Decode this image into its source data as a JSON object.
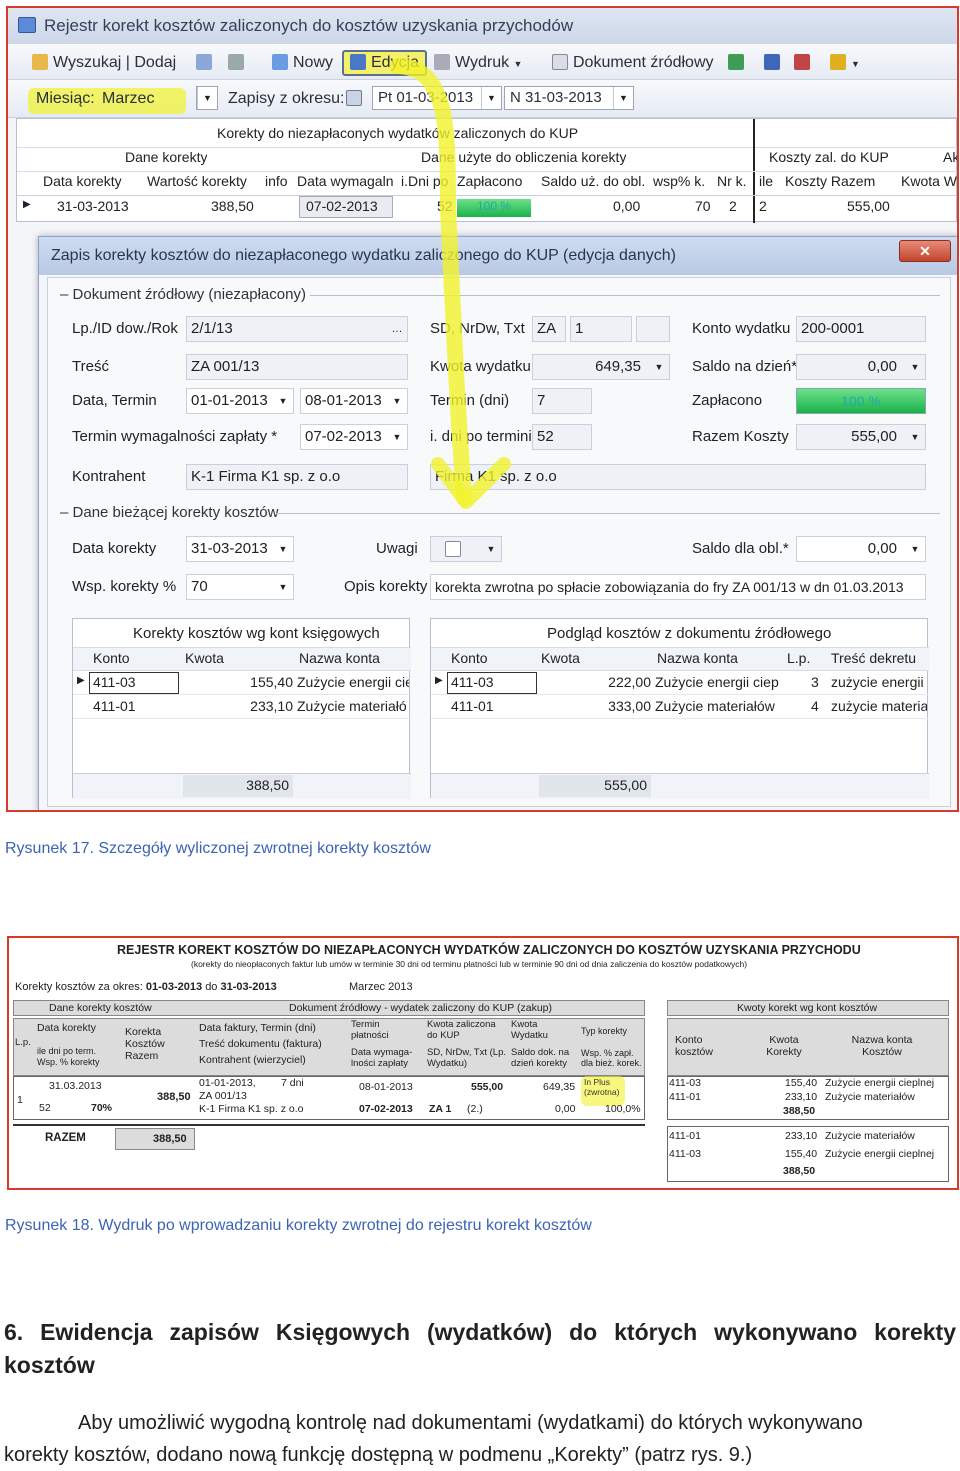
{
  "window": {
    "title": "Rejestr korekt kosztów zaliczonych do kosztów uzyskania przychodów"
  },
  "toolbar": {
    "search_add": "Wyszukaj | Dodaj",
    "new": "Nowy",
    "edit": "Edycja",
    "print": "Wydruk",
    "source_doc": "Dokument źródłowy"
  },
  "filter": {
    "month_label": "Miesiąc:",
    "month_value": "Marzec",
    "range_label": "Zapisy z okresu:",
    "from": "Pt 01-03-2013",
    "to": "N 31-03-2013"
  },
  "main_grid": {
    "band1": "Korekty do niezapłaconych wydatków zaliczonych do KUP",
    "band2a": "Dane korekty",
    "band2b": "Dane użyte do obliczenia korekty",
    "band2c": "Koszty zal. do KUP",
    "band2d": "Akt",
    "headers": [
      "Data korekty",
      "Wartość korekty",
      "info",
      "Data wymagaln",
      "i.Dni po",
      "Zapłacono",
      "Saldo uż. do obl.",
      "wsp% k.",
      "Nr k.",
      "ile",
      "Koszty Razem",
      "Kwota Wy"
    ],
    "row": {
      "date": "31-03-2013",
      "value": "388,50",
      "due": "07-02-2013",
      "days": "52",
      "paid": "100 %",
      "saldo": "0,00",
      "wsp": "70",
      "nr": "2",
      "ile": "2",
      "total": "555,00"
    }
  },
  "dialog": {
    "title": "Zapis korekty kosztów do niezapłaconego wydatku zaliczonego do KUP  (edycja danych)",
    "close": "✕",
    "section1": "Dokument źródłowy  (niezapłacony)",
    "lp_label": "Lp./ID dow./Rok",
    "lp_value": "2/1/13",
    "sd_label": "SD, NrDw, Txt",
    "sd_value": "ZA",
    "nr_value": "1",
    "konto_label": "Konto wydatku",
    "konto_value": "200-0001",
    "tresc_label": "Treść",
    "tresc_value": "ZA 001/13",
    "kwota_label": "Kwota wydatku",
    "kwota_value": "649,35",
    "saldo_dzien_label": "Saldo na dzień*",
    "saldo_dzien_value": "0,00",
    "data_label": "Data, Termin",
    "data_value": "01-01-2013",
    "termin_value": "08-01-2013",
    "termin_dni_label": "Termin (dni)",
    "termin_dni_value": "7",
    "zaplacono_label": "Zapłacono",
    "zaplacono_value": "100 %",
    "wymag_label": "Termin wymagalności zapłaty *",
    "wymag_value": "07-02-2013",
    "dni_po_label": "i. dni po terminie",
    "dni_po_value": "52",
    "razem_label": "Razem Koszty",
    "razem_value": "555,00",
    "kontrahent_label": "Kontrahent",
    "kontrahent_value": "K-1   Firma K1 sp. z o.o",
    "kontrahent_value2": "Firma K1 sp. z o.o",
    "section2": "Dane bieżącej korekty kosztów",
    "data_korekty_label": "Data korekty",
    "data_korekty_value": "31-03-2013",
    "uwagi_label": "Uwagi",
    "saldo_obl_label": "Saldo dla obl.*",
    "saldo_obl_value": "0,00",
    "wsp_label": "Wsp. korekty %",
    "wsp_value": "70",
    "opis_label": "Opis korekty",
    "opis_value": "korekta zwrotna po spłacie zobowiązania do fry ZA 001/13 w dn 01.03.2013",
    "left_grid": {
      "title": "Korekty kosztów wg kont księgowych",
      "headers": [
        "Konto",
        "Kwota",
        "Nazwa konta"
      ],
      "rows": [
        [
          "411-03",
          "155,40",
          "Zużycie energii cie"
        ],
        [
          "411-01",
          "233,10",
          "Zużycie materiałó"
        ]
      ],
      "total": "388,50"
    },
    "right_grid": {
      "title": "Podgląd kosztów z dokumentu źródłowego",
      "headers": [
        "Konto",
        "Kwota",
        "Nazwa konta",
        "L.p.",
        "Treść dekretu"
      ],
      "rows": [
        [
          "411-03",
          "222,00",
          "Zużycie energii ciep",
          "3",
          "zużycie energii"
        ],
        [
          "411-01",
          "333,00",
          "Zużycie materiałów",
          "4",
          "zużycie materiał"
        ]
      ],
      "total": "555,00"
    }
  },
  "caption1": "Rysunek 17. Szczegóły  wyliczonej zwrotnej korekty kosztów",
  "report": {
    "title": "REJESTR KOREKT KOSZTÓW DO NIEZAPŁACONYCH WYDATKÓW ZALICZONYCH DO KOSZTÓW UZYSKANIA PRZYCHODU",
    "subtitle": "(korekty do nieopłaconych faktur lub umów w terminie 30 dni od terminu płatności lub w terminie 90 dni od dnia zaliczenia do kosztów podatkowych)",
    "period_label": "Korekty kosztów za okres:",
    "from": "01-03-2013",
    "to_label": "do",
    "to": "31-03-2013",
    "month": "Marzec 2013",
    "g1": "Dane korekty kosztów",
    "g2": "Dokument źródłowy - wydatek zaliczony do KUP (zakup)",
    "g3": "Kwoty korekt wg kont kosztów",
    "h_lp": "L.p.",
    "h_data_korekty": "Data korekty",
    "h_dni_po": "ile dni po term.",
    "h_wsp": "Wsp. % korekty",
    "h_korekta": "Korekta Kosztów Razem",
    "h_data_faktury": "Data faktury,  Termin (dni)",
    "h_tresc": "Treść dokumentu (faktura)",
    "h_kontrahent": "Kontrahent (wierzyciel)",
    "h_termin_pl": "Termin płatności",
    "h_data_wym": "Data wymaga-lności zapłaty",
    "h_kwota_zal": "Kwota zaliczona do KUP",
    "h_sd": "SD, NrDw, Txt (Lp. Wydatku)",
    "h_kwota_wyd": "Kwota Wydatku",
    "h_saldo": "Saldo dok. na dzień korekty",
    "h_typ": "Typ korekty",
    "h_wsp2": "Wsp. % zapł. dla bież. korek.",
    "h_konto": "Konto kosztów",
    "h_kwota_k": "Kwota Korekty",
    "h_nazwa": "Nazwa konta Kosztów",
    "lp": "1",
    "data_korekty": "31.03.2013",
    "dni": "52",
    "wsp": "70%",
    "korekta": "388,50",
    "data_faktury": "01-01-2013,",
    "termin_dni": "7 dni",
    "tresc": "ZA 001/13",
    "kontrahent": "K-1  Firma K1 sp. z o.o",
    "termin_pl": "08-01-2013",
    "data_wym": "07-02-2013",
    "kwota_zal": "555,00",
    "sd": "ZA  1",
    "lp_wyd": "(2.)",
    "kwota_wyd": "649,35",
    "saldo": "0,00",
    "typ": "In Plus (zwrotna)",
    "wsp_zapl": "100,0%",
    "k_rows": [
      [
        "411-03",
        "155,40",
        "Zużycie energii cieplnej"
      ],
      [
        "411-01",
        "233,10",
        "Zużycie materiałów"
      ]
    ],
    "k_total": "388,50",
    "s_rows": [
      [
        "411-01",
        "233,10",
        "Zużycie materiałów"
      ],
      [
        "411-03",
        "155,40",
        "Zużycie energii cieplnej"
      ]
    ],
    "s_total": "388,50",
    "razem_label": "RAZEM",
    "razem_value": "388,50"
  },
  "caption2": "Rysunek 18. Wydruk po wprowadzaniu korekty zwrotnej do rejestru korekt kosztów",
  "heading_line1": "6.  Ewidencja  zapisów  Księgowych  (wydatków)  do  których  wykonywano  korekty",
  "heading_line2": "kosztów",
  "para_line1": "Aby  umożliwić  wygodną  kontrolę  nad  dokumentami  (wydatkami)  do  których  wykonywano",
  "para_line2": "korekty kosztów, dodano nową funkcję dostępną w podmenu „Korekty” (patrz rys. 9.)"
}
